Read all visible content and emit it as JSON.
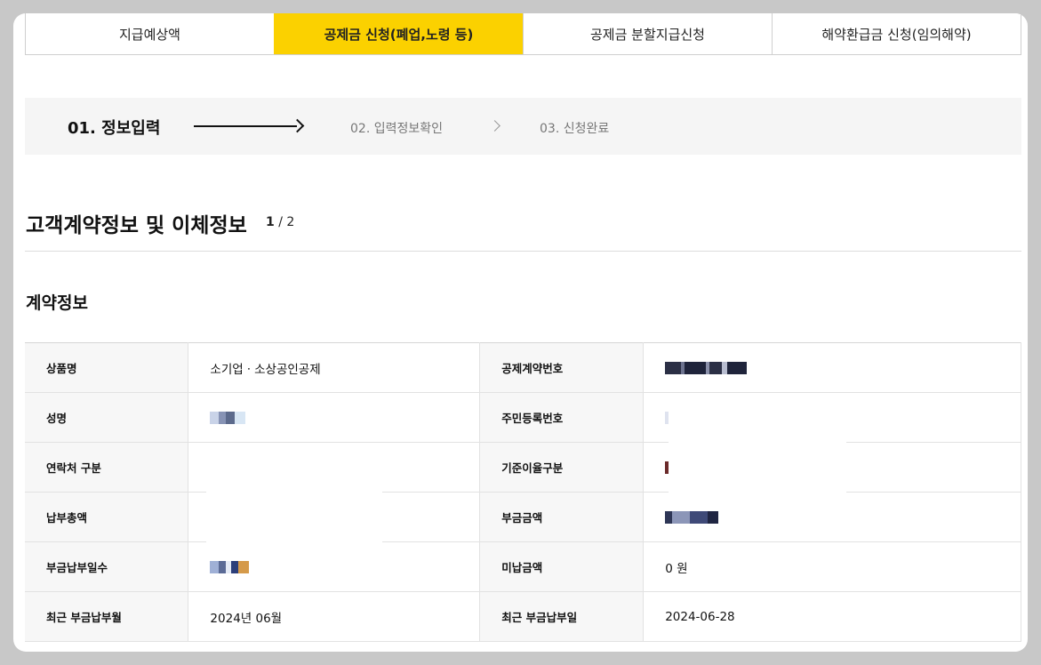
{
  "tabs": [
    {
      "label": "지급예상액",
      "active": false
    },
    {
      "label": "공제금 신청(폐업,노령 등)",
      "active": true
    },
    {
      "label": "공제금 분할지급신청",
      "active": false
    },
    {
      "label": "해약환급금 신청(임의해약)",
      "active": false
    }
  ],
  "steps": {
    "step1": "01. 정보입력",
    "step2": "02. 입력정보확인",
    "step3": "03. 신청완료"
  },
  "section": {
    "title": "고객계약정보 및 이체정보",
    "page_current": "1",
    "page_total": "/ 2",
    "subtitle": "계약정보"
  },
  "rows": [
    {
      "label1": "상품명",
      "value1": "소기업ㆍ소상공인공제",
      "label2": "공제계약번호",
      "value2": ""
    },
    {
      "label1": "성명",
      "value1": "",
      "label2": "주민등록번호",
      "value2": ""
    },
    {
      "label1": "연락처 구분",
      "value1": "",
      "label2": "기준이율구분",
      "value2": ""
    },
    {
      "label1": "납부총액",
      "value1": "",
      "label2": "부금금액",
      "value2": ""
    },
    {
      "label1": "부금납부일수",
      "value1": "",
      "label2": "미납금액",
      "value2": "0 원"
    },
    {
      "label1": "최근 부금납부월",
      "value1": "2024년 06월",
      "label2": "최근 부금납부일",
      "value2": "2024-06-28"
    }
  ],
  "colors": {
    "accent": "#fbd100",
    "header_bg": "#f7f7f7",
    "steps_bg": "#f5f5f5"
  }
}
